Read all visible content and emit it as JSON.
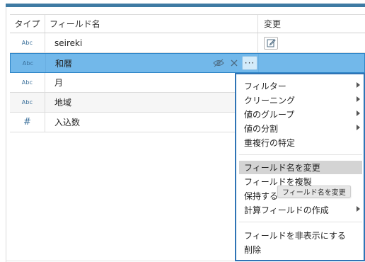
{
  "colors": {
    "accent": "#3e7aa3",
    "selected_row": "#72b8ea",
    "menu_border": "#2f74b5"
  },
  "table": {
    "headers": {
      "type": "タイプ",
      "field_name": "フィールド名",
      "change": "変更"
    },
    "rows": [
      {
        "type_label": "Abc",
        "type_icon": "text-type-icon",
        "name": "seireki"
      },
      {
        "type_label": "Abc",
        "type_icon": "text-type-icon",
        "name": "和暦"
      },
      {
        "type_label": "Abc",
        "type_icon": "text-type-icon",
        "name": "月"
      },
      {
        "type_label": "Abc",
        "type_icon": "text-type-icon",
        "name": "地域"
      },
      {
        "type_label": "#",
        "type_icon": "number-type-icon",
        "name": "入込数"
      }
    ]
  },
  "row_actions": {
    "hide_icon": "eye-off-icon",
    "remove_icon": "close-icon",
    "more_label": "···"
  },
  "context_menu": {
    "items": [
      {
        "label": "フィルター",
        "submenu": true
      },
      {
        "label": "クリーニング",
        "submenu": true
      },
      {
        "label": "値のグループ",
        "submenu": true
      },
      {
        "label": "値の分割",
        "submenu": true
      },
      {
        "label": "重複行の特定",
        "submenu": false
      },
      {
        "label": "フィールド名を変更",
        "submenu": false,
        "active": true
      },
      {
        "label": "フィールドを複製",
        "submenu": false
      },
      {
        "label": "保持する",
        "submenu": false
      },
      {
        "label": "計算フィールドの作成",
        "submenu": true
      },
      {
        "label": "フィールドを非表示にする",
        "submenu": false
      },
      {
        "label": "削除",
        "submenu": false
      }
    ]
  },
  "tooltip": {
    "text": "フィールド名を変更"
  }
}
